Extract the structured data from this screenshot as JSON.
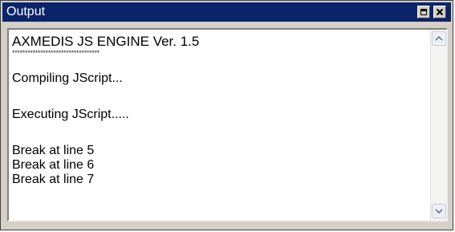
{
  "window": {
    "title": "Output"
  },
  "output": {
    "lines": [
      "AXMEDIS JS ENGINE Ver. 1.5",
      "**********************************",
      "Compiling JScript...",
      "Executing JScript.....",
      "Break at line 5",
      "Break at line 6",
      "Break at line 7"
    ]
  },
  "icons": {
    "restore": "restore-icon",
    "close": "close-icon",
    "scroll_up": "chevron-up-icon",
    "scroll_down": "chevron-down-icon"
  },
  "colors": {
    "titlebar": "#0a246a",
    "title_text": "#ffffff",
    "window_face": "#d4d0c8",
    "output_background": "#ffffff"
  }
}
